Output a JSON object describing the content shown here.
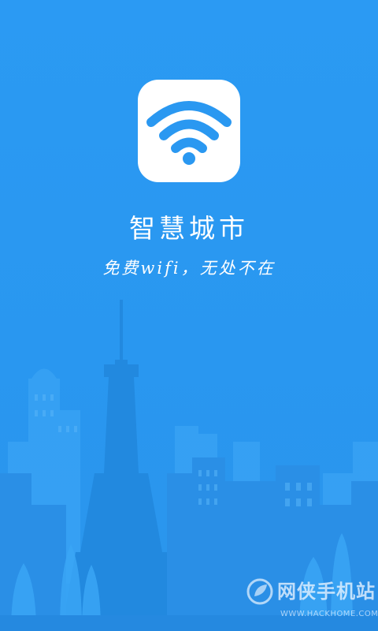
{
  "app": {
    "title": "智慧城市",
    "slogan": "免费wifi，无处不在",
    "icon": "wifi-icon"
  },
  "colors": {
    "background": "#2a98f1",
    "icon_background": "#ffffff",
    "icon_glyph": "#2a98f1",
    "skyline": "#2489e0"
  },
  "watermark": {
    "text": "网侠手机站",
    "url": "WWW.HACKHOME.COM",
    "icon": "leaf-logo-icon"
  }
}
